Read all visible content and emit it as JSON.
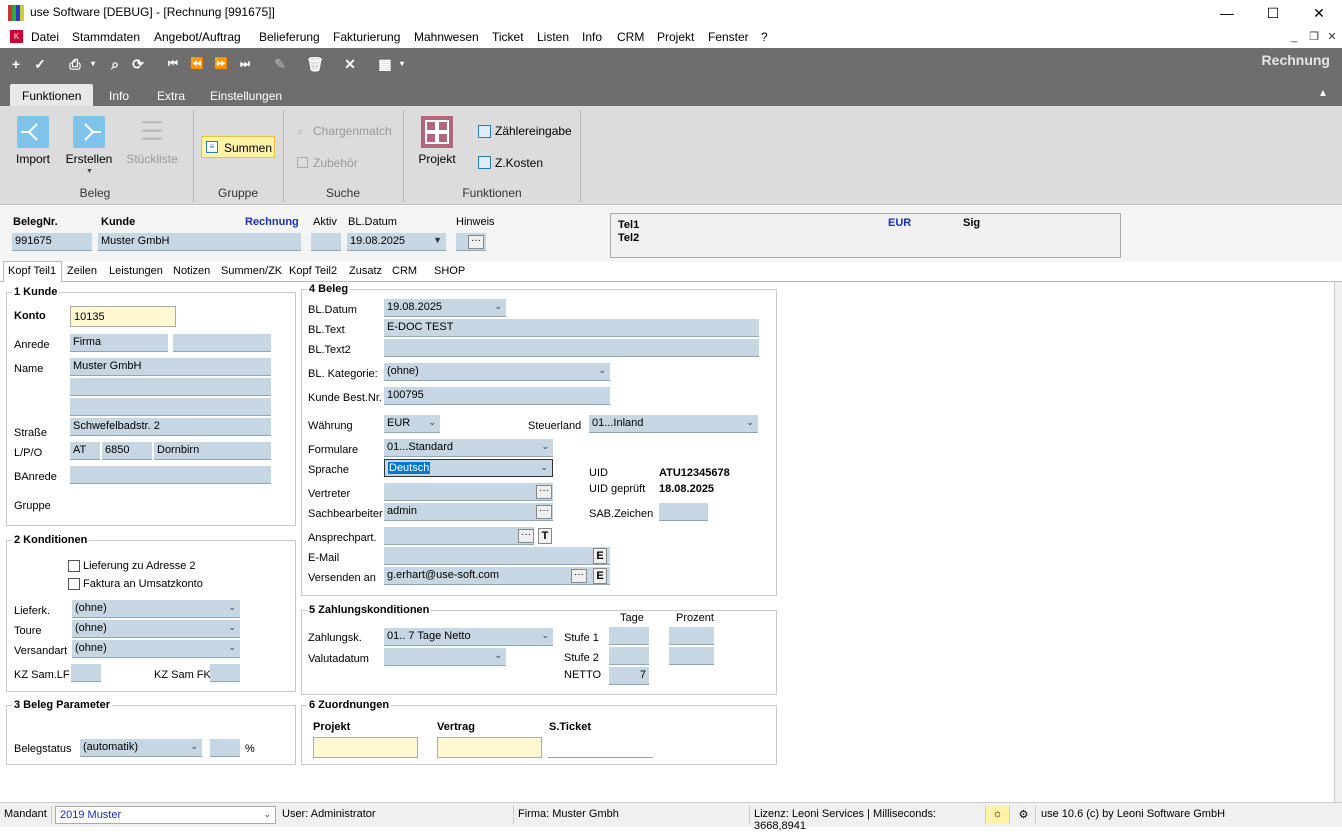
{
  "window": {
    "title": "use Software [DEBUG] - [Rechnung [991675]]"
  },
  "menu": [
    "Datei",
    "Stammdaten",
    "Angebot/Auftrag",
    "Belieferung",
    "Fakturierung",
    "Mahnwesen",
    "Ticket",
    "Listen",
    "Info",
    "CRM",
    "Projekt",
    "Fenster",
    "?"
  ],
  "view_title": "Rechnung",
  "ribbon_tabs": [
    "Funktionen",
    "Info",
    "Extra",
    "Einstellungen"
  ],
  "ribbon": {
    "import": "Import",
    "erstellen": "Erstellen",
    "stueckliste": "Stückliste",
    "beleg": "Beleg",
    "summen": "Summen",
    "gruppe": "Gruppe",
    "chargenmatch": "Chargenmatch",
    "zubehoer": "Zubehör",
    "suche": "Suche",
    "projekt": "Projekt",
    "zaehlereingabe": "Zählereingabe",
    "zkosten": "Z.Kosten",
    "funktionen": "Funktionen"
  },
  "header": {
    "belegnr_label": "BelegNr.",
    "belegnr": "991675",
    "kunde_label": "Kunde",
    "kunde": "Muster GmbH",
    "doc_type": "Rechnung",
    "aktiv_label": "Aktiv",
    "bldatum_label": "BL.Datum",
    "bldatum": "19.08.2025",
    "hinweis_label": "Hinweis",
    "tel1": "Tel1",
    "tel2": "Tel2",
    "currency": "EUR",
    "sig": "Sig"
  },
  "page_tabs": [
    "Kopf Teil1",
    "Zeilen",
    "Leistungen",
    "Notizen",
    "Summen/ZK",
    "Kopf Teil2",
    "Zusatz",
    "CRM",
    "SHOP"
  ],
  "kunde": {
    "title": "1 Kunde",
    "konto_label": "Konto",
    "konto": "10135",
    "anrede_label": "Anrede",
    "anrede": "Firma",
    "name_label": "Name",
    "name": "Muster GmbH",
    "strasse_label": "Straße",
    "strasse": "Schwefelbadstr. 2",
    "lpo_label": "L/P/O",
    "land": "AT",
    "plz": "6850",
    "ort": "Dornbirn",
    "banrede_label": "BAnrede",
    "gruppe_label": "Gruppe"
  },
  "konditionen": {
    "title": "2 Konditionen",
    "lieferung": "Lieferung zu Adresse 2",
    "faktura": "Faktura an Umsatzkonto",
    "lieferk_label": "Lieferk.",
    "lieferk": "(ohne)",
    "toure_label": "Toure",
    "toure": "(ohne)",
    "versandart_label": "Versandart",
    "versandart": "(ohne)",
    "kzlf_label": "KZ Sam.LF",
    "kzfk_label": "KZ Sam FK"
  },
  "parameter": {
    "title": "3 Beleg Parameter",
    "belegstatus_label": "Belegstatus",
    "belegstatus": "(automatik)",
    "percent": "%"
  },
  "beleg": {
    "title": "4 Beleg",
    "bldatum_label": "BL.Datum",
    "bldatum": "19.08.2025",
    "bltext_label": "BL.Text",
    "bltext": "E-DOC TEST",
    "bltext2_label": "BL.Text2",
    "kategorie_label": "BL. Kategorie:",
    "kategorie": "(ohne)",
    "bestnr_label": "Kunde Best.Nr.",
    "bestnr": "100795",
    "waehrung_label": "Währung",
    "waehrung": "EUR",
    "steuerland_label": "Steuerland",
    "steuerland": "01...Inland",
    "formulare_label": "Formulare",
    "formulare": "01...Standard",
    "sprache_label": "Sprache",
    "sprache": "Deutsch",
    "uid_label": "UID",
    "uid": "ATU12345678",
    "uidgeprueft_label": "UID geprüft",
    "uidgeprueft": "18.08.2025",
    "vertreter_label": "Vertreter",
    "sachbearbeiter_label": "Sachbearbeiter",
    "sachbearbeiter": "admin",
    "sab_label": "SAB.Zeichen",
    "ansprech_label": "Ansprechpart.",
    "email_label": "E-Mail",
    "versenden_label": "Versenden an",
    "versenden": "g.erhart@use-soft.com"
  },
  "zahlung": {
    "title": "5 Zahlungskonditionen",
    "tage": "Tage",
    "prozent": "Prozent",
    "zahlungsk_label": "Zahlungsk.",
    "zahlungsk": "01.. 7 Tage Netto",
    "valuta_label": "Valutadatum",
    "stufe1": "Stufe 1",
    "stufe2": "Stufe 2",
    "netto": "NETTO",
    "netto_tage": "7"
  },
  "zuordnungen": {
    "title": "6 Zuordnungen",
    "projekt": "Projekt",
    "vertrag": "Vertrag",
    "sticket": "S.Ticket"
  },
  "statusbar": {
    "mandant_label": "Mandant",
    "mandant": "2019 Muster",
    "user": "User: Administrator",
    "firma": "Firma: Muster Gmbh",
    "lizenz": "Lizenz: Leoni Services | Milliseconds: 3668,8941",
    "version": "use 10.6 (c) by Leoni Software GmbH"
  },
  "colors": {
    "accent_blue": "#1a2fb8",
    "field": "#c7d6e3",
    "toolbar": "#6e6e6e",
    "ribbon": "#dcdcdc"
  }
}
